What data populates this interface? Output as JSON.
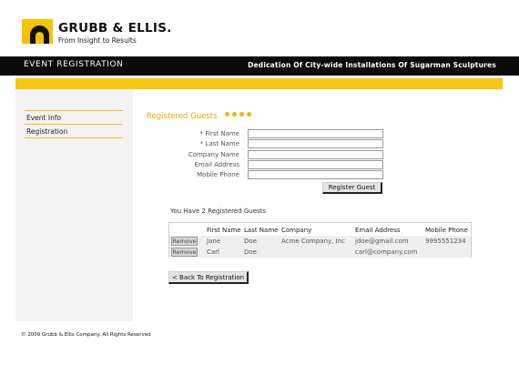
{
  "brand": {
    "name": "GRUBB & ELLIS.",
    "tagline": "From Insight to Results"
  },
  "title_bar": {
    "section": "EVENT REGISTRATION",
    "event_name": "Dedication Of City-wide Installations Of Sugarman Sculptures"
  },
  "sidebar": {
    "items": [
      {
        "label": "Event Info"
      },
      {
        "label": "Registration"
      }
    ]
  },
  "main": {
    "title": "Registered Guests",
    "form": {
      "fields": [
        {
          "label": "* First Name",
          "value": ""
        },
        {
          "label": "* Last Name",
          "value": ""
        },
        {
          "label": "Company Name",
          "value": ""
        },
        {
          "label": "Email Address",
          "value": ""
        },
        {
          "label": "Mobile Phone",
          "value": ""
        }
      ],
      "submit_label": "Register Guest"
    },
    "guest_count_text": "You Have 2 Registered Guests",
    "table": {
      "headers": [
        "First Name",
        "Last Name",
        "Company",
        "Email Address",
        "Mobile Phone"
      ],
      "remove_label": "Remove",
      "rows": [
        {
          "first": "Jane",
          "last": "Doe",
          "company": "Acme Company, Inc",
          "email": "jdoe@gmail.com",
          "phone": "9995551234"
        },
        {
          "first": "Carl",
          "last": "Doe",
          "company": "",
          "email": "carl@company.com",
          "phone": ""
        }
      ]
    },
    "back_label": "< Back To Registration"
  },
  "footer": {
    "copyright": "© 2009 Grubb & Ellis Company. All Rights Reserved"
  },
  "colors": {
    "accent_yellow": "#f8c512",
    "title_bar": "#0a0a0a",
    "heading": "#e8a800"
  }
}
